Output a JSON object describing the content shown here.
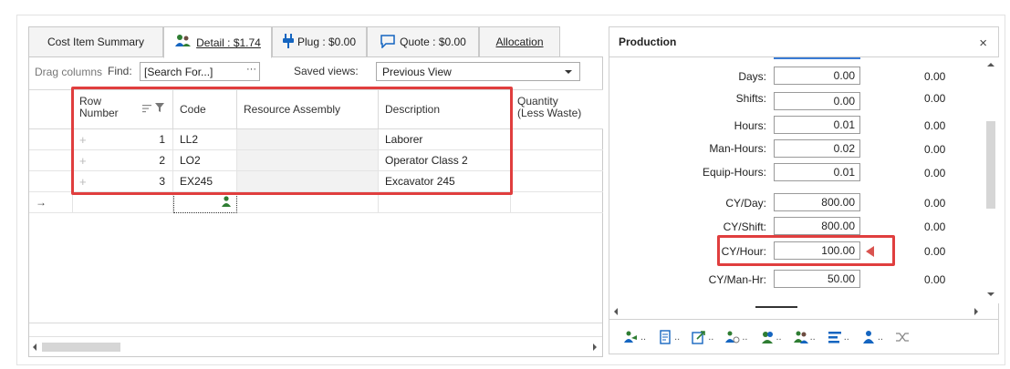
{
  "tabs": [
    {
      "label": "Cost Item Summary",
      "underline": "o"
    },
    {
      "label": "Detail : $1.74",
      "icon": "workers-icon"
    },
    {
      "label": "Plug : $0.00",
      "icon": "plug-icon"
    },
    {
      "label": "Quote : $0.00",
      "icon": "quote-icon"
    },
    {
      "label": "Allocation"
    }
  ],
  "toolbar": {
    "drag_hint": "Drag columns",
    "find_label": "Find:",
    "search_value": "[Search For...]",
    "search_more": "···",
    "saved_views_label": "Saved views:",
    "saved_view_value": "Previous View"
  },
  "grid": {
    "columns": [
      "Row Number",
      "Code",
      "Resource Assembly",
      "Description",
      "Quantity (Less Waste)"
    ],
    "col_row_number_line1": "Row",
    "col_row_number_line2": "Number",
    "col_quantity_line1": "Quantity",
    "col_quantity_line2": "(Less Waste)",
    "rows": [
      {
        "row": "1",
        "code": "LL2",
        "assembly": "",
        "description": "Laborer"
      },
      {
        "row": "2",
        "code": "LO2",
        "assembly": "",
        "description": "Operator Class 2"
      },
      {
        "row": "3",
        "code": "EX245",
        "assembly": "",
        "description": "Excavator 245"
      }
    ],
    "new_row_arrow": "→",
    "expand_glyph": "+"
  },
  "production": {
    "title": "Production",
    "close": "×",
    "rows": [
      {
        "label": "Days:",
        "input": "0.00",
        "value": "0.00"
      },
      {
        "label": "Shifts:",
        "input": "0.00",
        "value": "0.00"
      },
      {
        "label": "Hours:",
        "input": "0.01",
        "value": "0.00"
      },
      {
        "label": "Man-Hours:",
        "input": "0.02",
        "value": "0.00"
      },
      {
        "label": "Equip-Hours:",
        "input": "0.01",
        "value": "0.00"
      },
      {
        "label": "CY/Day:",
        "input": "800.00",
        "value": "0.00"
      },
      {
        "label": "CY/Shift:",
        "input": "800.00",
        "value": "0.00"
      },
      {
        "label": "CY/Hour:",
        "input": "100.00",
        "value": "0.00"
      },
      {
        "label": "CY/Man-Hr:",
        "input": "50.00",
        "value": "0.00"
      }
    ],
    "toolbar_dots": ".."
  },
  "colors": {
    "highlight": "#e03e3e",
    "accent": "#3a7bd5"
  }
}
